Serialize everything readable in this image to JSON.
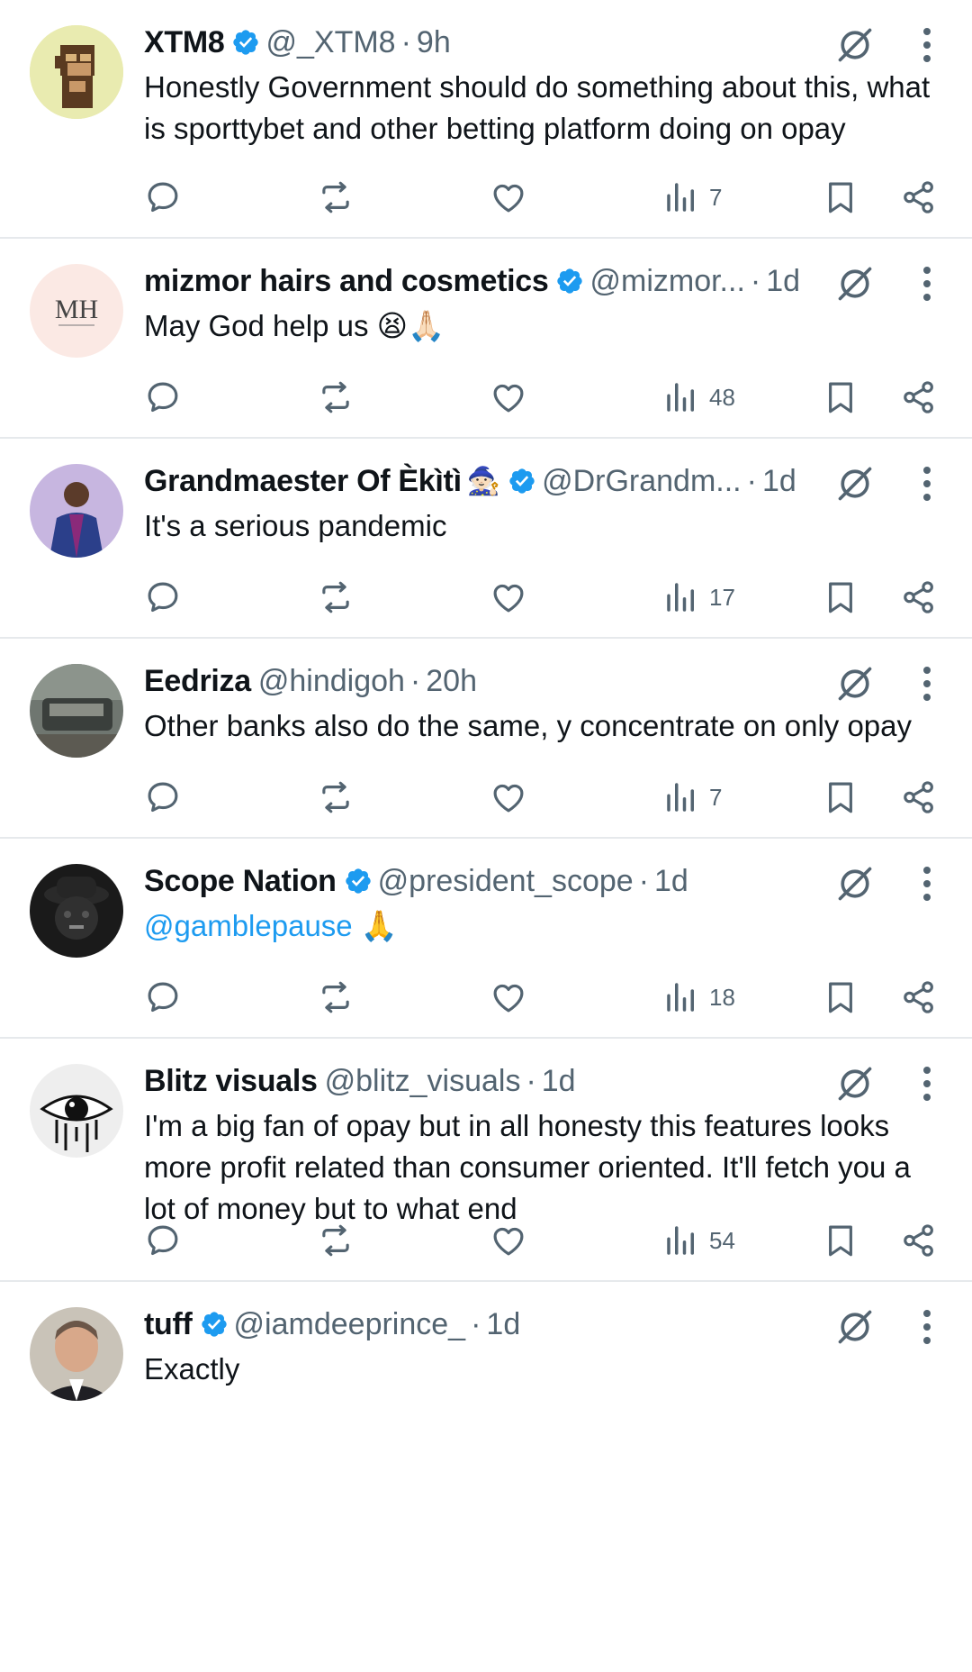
{
  "tweets": [
    {
      "name": "XTM8",
      "verified": true,
      "handle": "@_XTM8",
      "time": "9h",
      "text": "Honestly Government should do something about this, what is sporttybet and other betting platform doing on opay",
      "views": "7"
    },
    {
      "name": "mizmor hairs and cosmetics",
      "verified": true,
      "handle": "@mizmor...",
      "time": "1d",
      "text": "May God help us 😫🙏🏻",
      "views": "48"
    },
    {
      "name": "Grandmaester Of Èkìtì",
      "name_emoji": "🧙🏻",
      "verified": true,
      "handle": "@DrGrandm...",
      "time": "1d",
      "text": "It's a serious pandemic",
      "views": "17"
    },
    {
      "name": "Eedriza",
      "verified": false,
      "handle": "@hindigoh",
      "time": "20h",
      "text": "Other banks also do the same, y concentrate on only opay",
      "views": "7"
    },
    {
      "name": "Scope Nation",
      "verified": true,
      "handle": "@president_scope",
      "time": "1d",
      "mention": "@gamblepause",
      "text": "🙏",
      "views": "18"
    },
    {
      "name": "Blitz visuals",
      "verified": false,
      "handle": "@blitz_visuals",
      "time": "1d",
      "text": "I'm a big fan of opay but in all honesty this features looks more profit related than consumer oriented. It'll fetch you a lot of money but to what end",
      "views": "54"
    },
    {
      "name": "tuff",
      "verified": true,
      "handle": "@iamdeeprince_",
      "time": "1d",
      "text": "Exactly"
    }
  ],
  "separator": "·",
  "colors": {
    "verified": "#1d9bf0",
    "link": "#1d9bf0",
    "secondary_text": "#536471",
    "divider": "#e6e9ec"
  },
  "icons": [
    "reply-icon",
    "retweet-icon",
    "like-icon",
    "views-icon",
    "bookmark-icon",
    "share-icon",
    "grok-icon",
    "more-icon",
    "verified-badge-icon"
  ]
}
